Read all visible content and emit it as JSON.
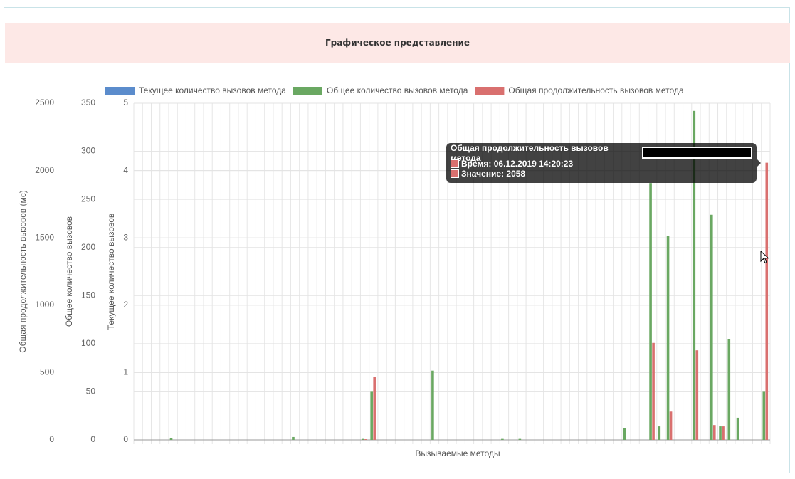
{
  "panel": {
    "title": "Графическое представление"
  },
  "colors": {
    "blue": "#5b8ccc",
    "green": "#6aa862",
    "red": "#d9706f",
    "header_bg": "#fde8e6"
  },
  "tooltip": {
    "title": "Общая продолжительность вызовов метода",
    "time_label": "Время: 06.12.2019 14:20:23",
    "value_label": "Значение: 2058"
  },
  "chart_data": {
    "type": "bar",
    "xlabel": "Вызываемые методы",
    "legend_position": "top",
    "grid": true,
    "x_tick_labels_visible": false,
    "category_count": 73,
    "series": [
      {
        "name": "Текущее количество вызовов метода",
        "color": "#5b8ccc",
        "axis": "y_current",
        "values": []
      },
      {
        "name": "Общее количество вызовов метода",
        "color": "#6aa862",
        "axis": "y_total",
        "points": [
          [
            5,
            2
          ],
          [
            19,
            3
          ],
          [
            27,
            1
          ],
          [
            28,
            50
          ],
          [
            35,
            72
          ],
          [
            43,
            1
          ],
          [
            45,
            1
          ],
          [
            57,
            12
          ],
          [
            60,
            267
          ],
          [
            61,
            14
          ],
          [
            62,
            212
          ],
          [
            65,
            342
          ],
          [
            67,
            234
          ],
          [
            68,
            14
          ],
          [
            69,
            105
          ],
          [
            70,
            23
          ],
          [
            73,
            50
          ]
        ]
      },
      {
        "name": "Общая продолжительность вызовов метода",
        "color": "#d9706f",
        "axis": "y_duration",
        "points": [
          [
            27,
            5
          ],
          [
            28,
            470
          ],
          [
            60,
            720
          ],
          [
            62,
            210
          ],
          [
            65,
            665
          ],
          [
            67,
            110
          ],
          [
            68,
            100
          ],
          [
            73,
            2058
          ]
        ]
      }
    ],
    "axes": {
      "y_duration": {
        "title": "Общая продолжительность вызовов (мс)",
        "min": 0,
        "max": 2500,
        "ticks": [
          "0",
          "500",
          "1000",
          "1500",
          "2000",
          "2500"
        ]
      },
      "y_total": {
        "title": "Общее количество вызовов",
        "min": 0,
        "max": 350,
        "ticks": [
          "0",
          "50",
          "100",
          "150",
          "200",
          "250",
          "300",
          "350"
        ]
      },
      "y_current": {
        "title": "Текущее количество вызовов",
        "min": 0,
        "max": 5,
        "ticks": [
          "0",
          "1",
          "2",
          "3",
          "4",
          "5"
        ]
      }
    }
  }
}
